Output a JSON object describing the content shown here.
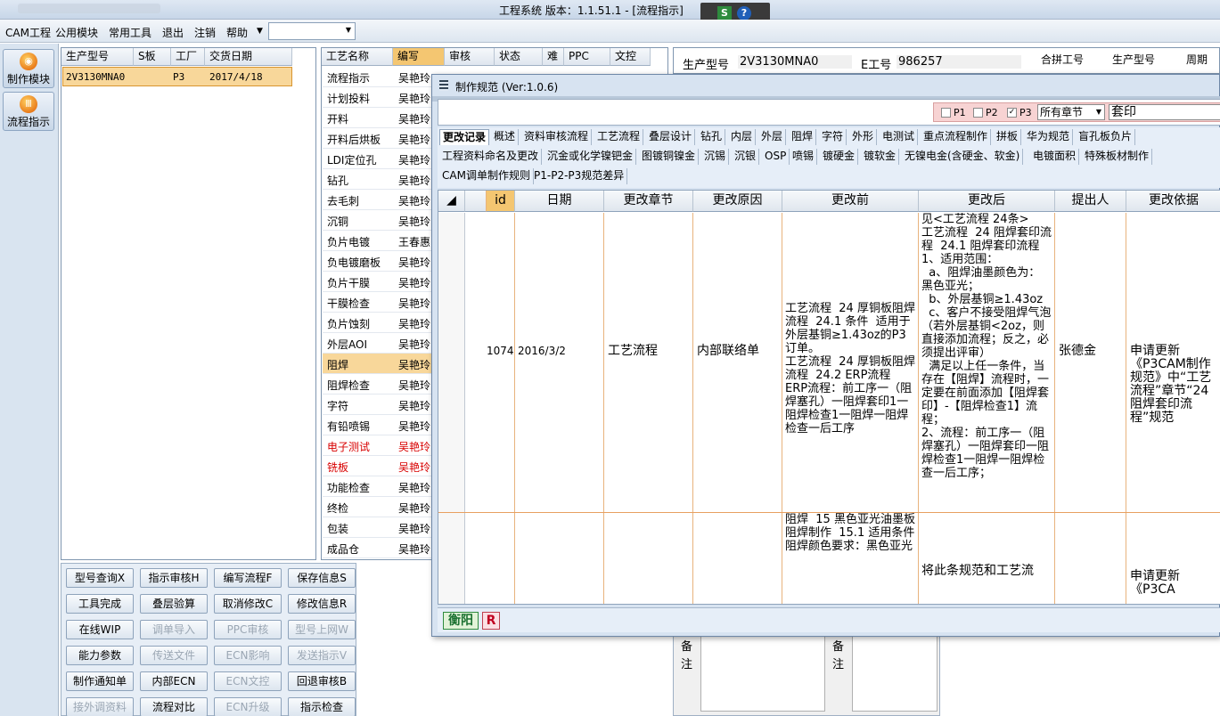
{
  "window": {
    "title": "工程系统    版本：1.1.51.1 - [流程指示]"
  },
  "menu": [
    "CAM工程",
    "公用模块",
    "常用工具",
    "退出",
    "注销",
    "帮助"
  ],
  "sidebar": {
    "buttons": [
      "制作模块",
      "流程指示"
    ]
  },
  "left_grid": {
    "headers": [
      "生产型号",
      "S板",
      "工厂",
      "交货日期"
    ],
    "row": {
      "model": "2V3130MNA0",
      "plant": "P3",
      "date": "2017/4/18"
    }
  },
  "proc_grid": {
    "headers": [
      "工艺名称",
      "编写",
      "审核",
      "状态",
      "难",
      "PPC",
      "文控"
    ],
    "rows": [
      {
        "name": "流程指示",
        "writer": "吴艳玲"
      },
      {
        "name": "计划投料",
        "writer": "吴艳玲"
      },
      {
        "name": "开料",
        "writer": "吴艳玲"
      },
      {
        "name": "开料后烘板",
        "writer": "吴艳玲"
      },
      {
        "name": "LDI定位孔",
        "writer": "吴艳玲"
      },
      {
        "name": "钻孔",
        "writer": "吴艳玲"
      },
      {
        "name": "去毛刺",
        "writer": "吴艳玲"
      },
      {
        "name": "沉铜",
        "writer": "吴艳玲"
      },
      {
        "name": "负片电镀",
        "writer": "王春惠"
      },
      {
        "name": "负电镀磨板",
        "writer": "吴艳玲"
      },
      {
        "name": "负片干膜",
        "writer": "吴艳玲"
      },
      {
        "name": "干膜检查",
        "writer": "吴艳玲"
      },
      {
        "name": "负片蚀刻",
        "writer": "吴艳玲"
      },
      {
        "name": "外层AOI",
        "writer": "吴艳玲"
      },
      {
        "name": "阻焊",
        "writer": "吴艳玲"
      },
      {
        "name": "阻焊检查",
        "writer": "吴艳玲"
      },
      {
        "name": "字符",
        "writer": "吴艳玲"
      },
      {
        "name": "有铅喷锡",
        "writer": "吴艳玲"
      },
      {
        "name": "电子测试",
        "writer": "吴艳玲"
      },
      {
        "name": "铣板",
        "writer": "吴艳玲"
      },
      {
        "name": "功能检查",
        "writer": "吴艳玲"
      },
      {
        "name": "终检",
        "writer": "吴艳玲"
      },
      {
        "name": "包装",
        "writer": "吴艳玲"
      },
      {
        "name": "成品仓",
        "writer": "吴艳玲"
      }
    ]
  },
  "right_info": {
    "model_label": "生产型号",
    "model": "2V3130MNA0",
    "e_label": "E工号",
    "e_no": "986257",
    "col1": "合拼工号",
    "col2": "生产型号",
    "col3": "周期"
  },
  "buttons": [
    [
      "型号查询X",
      "指示审核H",
      "编写流程F",
      "保存信息S"
    ],
    [
      "工具完成",
      "叠层验算",
      "取消修改C",
      "修改信息R"
    ],
    [
      "在线WIP",
      "调单导入",
      "PPC审核",
      "型号上网W"
    ],
    [
      "能力参数",
      "传送文件",
      "ECN影响",
      "发送指示V"
    ],
    [
      "制作通知单",
      "内部ECN",
      "ECN文控",
      "回退审核B"
    ],
    [
      "接外调资料",
      "流程对比",
      "ECN升级",
      "指示检查"
    ]
  ],
  "remarks": [
    "备注",
    "备注"
  ],
  "dialog": {
    "title": "制作规范 (Ver:1.0.6)",
    "checks": [
      {
        "label": "P1",
        "checked": false
      },
      {
        "label": "P2",
        "checked": false
      },
      {
        "label": "P3",
        "checked": true
      }
    ],
    "chapter": "所有章节",
    "search": "套印",
    "tabs1": [
      "更改记录",
      "概述",
      "资料审核流程",
      "工艺流程",
      "叠层设计",
      "钻孔",
      "内层",
      "外层",
      "阻焊",
      "字符",
      "外形",
      "电测试",
      "重点流程制作",
      "拼板",
      "华为规范",
      "盲孔板负片"
    ],
    "tabs2": [
      "工程资料命名及更改",
      "沉金或化学镍钯金",
      "图镀铜镍金",
      "沉锡",
      "沉银",
      "OSP",
      "喷锡",
      "镀硬金",
      "镀软金",
      "无镍电金(含硬金、软金)",
      "电镀面积",
      "特殊板材制作"
    ],
    "tabs3": [
      "CAM调单制作规则",
      "P1-P2-P3规范差异"
    ],
    "columns": [
      "id",
      "日期",
      "更改章节",
      "更改原因",
      "更改前",
      "更改后",
      "提出人",
      "更改依据"
    ],
    "row1": {
      "id": "1074",
      "date": "2016/3/2",
      "chapter": "工艺流程",
      "reason": "内部联络单",
      "before": "工艺流程  24 厚铜板阻焊流程  24.1 条件  适用于外层基铜≥1.43oz的P3订单。\n工艺流程  24 厚铜板阻焊流程  24.2 ERP流程  ERP流程：前工序一（阻焊塞孔）一阻焊套印1一阻焊检查1一阻焊一阻焊检查一后工序",
      "after": "见<工艺流程 24条>\n工艺流程  24 阻焊套印流程  24.1 阻焊套印流程\n1、适用范围：\n  a、阻焊油墨颜色为：黑色亚光；\n  b、外层基铜≥1.43oz\n  c、客户不接受阻焊气泡（若外层基铜<2oz，则直接添加流程；反之，必须提出评审）\n  满足以上任一条件，当存在【阻焊】流程时，一定要在前面添加【阻焊套印】-【阻焊检查1】流程；\n2、流程：前工序一（阻焊塞孔）一阻焊套印一阻焊检查1一阻焊一阻焊检查一后工序；",
      "proposer": "张德金",
      "basis": "申请更新《P3CAM制作规范》中“工艺流程”章节“24 阻焊套印流程”规范"
    },
    "row2": {
      "before": "阻焊  15 黑色亚光油墨板阻焊制作  15.1 适用条件  阻焊颜色要求：黑色亚光",
      "after": "将此条规范和工艺流",
      "basis": "申请更新《P3CA"
    },
    "status": {
      "g": "衡阳",
      "r": "R"
    }
  }
}
